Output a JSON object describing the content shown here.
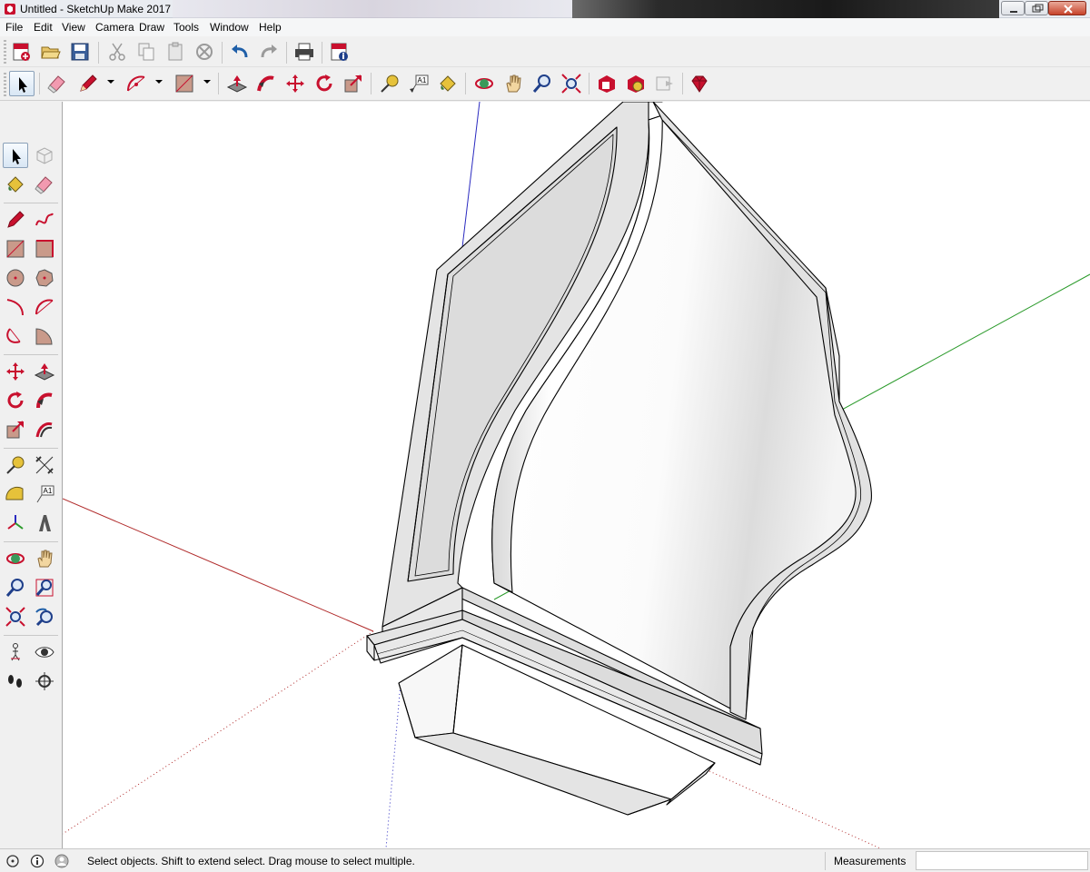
{
  "window": {
    "title": "Untitled - SketchUp Make 2017"
  },
  "menu": {
    "items": [
      "File",
      "Edit",
      "View",
      "Camera",
      "Draw",
      "Tools",
      "Window",
      "Help"
    ]
  },
  "toolbar_top": {
    "icons": [
      "new-file-icon",
      "open-folder-icon",
      "save-icon",
      "cut-icon",
      "copy-icon",
      "paste-icon",
      "erase-icon",
      "undo-icon",
      "redo-icon",
      "print-icon",
      "model-info-icon"
    ]
  },
  "toolbar_main": {
    "icons": [
      "select-icon",
      "eraser-icon",
      "pencil-icon",
      "arc-icon",
      "rectangle-icon",
      "push-pull-icon",
      "follow-me-icon",
      "move-icon",
      "rotate-icon",
      "scale-icon",
      "tape-measure-icon",
      "text-label-icon",
      "paint-bucket-icon",
      "orbit-icon",
      "pan-icon",
      "zoom-icon",
      "zoom-extents-icon",
      "3d-warehouse-icon",
      "extension-warehouse-icon",
      "layout-icon",
      "extension-manager-icon"
    ]
  },
  "status": {
    "hint": "Select objects. Shift to extend select. Drag mouse to select multiple.",
    "measurements_label": "Measurements",
    "measurements_value": ""
  },
  "colors": {
    "axis_red": "#b02a2a",
    "axis_green": "#2a9a2a",
    "axis_blue": "#2a2ac0",
    "face_light": "#e6e6e6",
    "face_white": "#ffffff",
    "edge": "#000000",
    "sketchup_red": "#c8102e"
  }
}
